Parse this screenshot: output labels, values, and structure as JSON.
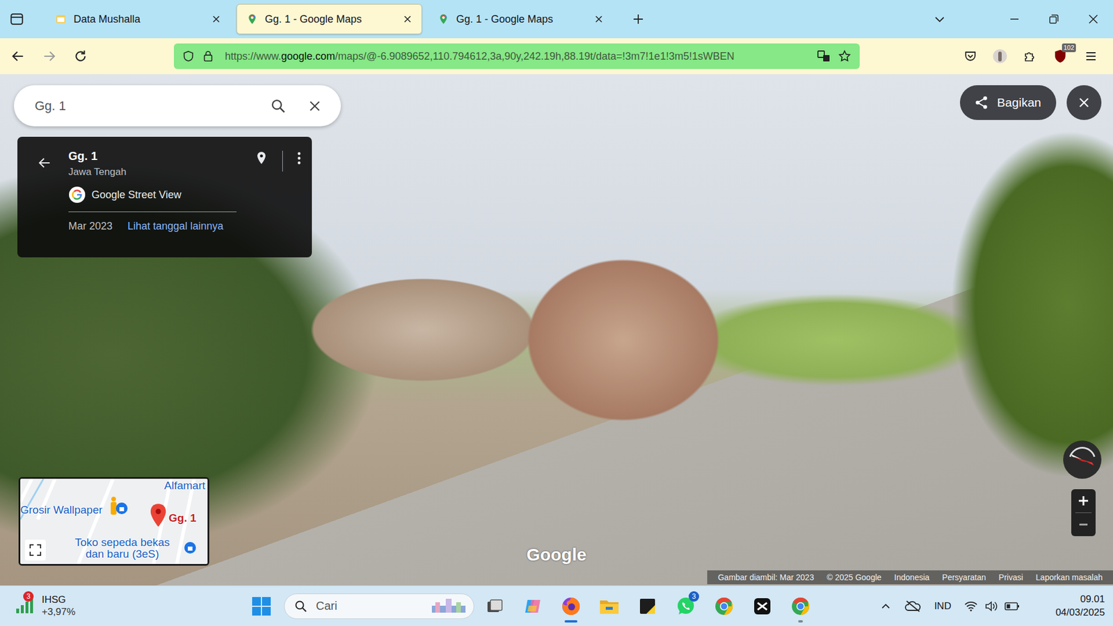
{
  "browser": {
    "tabs": [
      {
        "label": "Data Mushalla",
        "selected": false,
        "kind": "sheet"
      },
      {
        "label": "Gg. 1 - Google Maps",
        "selected": true,
        "kind": "maps"
      },
      {
        "label": "Gg. 1 - Google Maps",
        "selected": false,
        "kind": "maps"
      }
    ],
    "url": {
      "prefix": "https://www.",
      "domain": "google.com",
      "path": "/maps/@-6.9089652,110.794612,3a,90y,242.19h,88.19t/data=!3m7!1e1!3m5!1sWBEN"
    },
    "extension_badge": "102"
  },
  "maps": {
    "search": {
      "value": "Gg. 1"
    },
    "place": {
      "title": "Gg. 1",
      "region": "Jawa Tengah",
      "source": "Google Street View",
      "date": "Mar 2023",
      "link": "Lihat tanggal lainnya"
    },
    "share_button": "Bagikan",
    "minimap": {
      "labels": [
        {
          "text": "Alfamart",
          "kind": "poi"
        },
        {
          "text": "Grosir Wallpaper",
          "kind": "poi"
        },
        {
          "text": "Gg. 1",
          "kind": "pin"
        },
        {
          "text": "Toko sepeda bekas dan baru (3eS)",
          "kind": "poi"
        }
      ]
    },
    "watermark": "Google",
    "footer": [
      "Gambar diambil: Mar 2023",
      "© 2025 Google",
      "Indonesia",
      "Persyaratan",
      "Privasi",
      "Laporkan masalah"
    ]
  },
  "taskbar": {
    "widget": {
      "badge": "3",
      "name": "IHSG",
      "change": "+3,97%"
    },
    "search_placeholder": "Cari",
    "apps": [
      {
        "kind": "taskview",
        "active": false,
        "running": false,
        "badge": ""
      },
      {
        "kind": "copilot",
        "active": false,
        "running": false,
        "badge": ""
      },
      {
        "kind": "firefox",
        "active": true,
        "running": true,
        "badge": ""
      },
      {
        "kind": "folder",
        "active": false,
        "running": false,
        "badge": ""
      },
      {
        "kind": "sticky",
        "active": false,
        "running": false,
        "badge": ""
      },
      {
        "kind": "whatsapp",
        "active": false,
        "running": false,
        "badge": "3"
      },
      {
        "kind": "chrome",
        "active": false,
        "running": false,
        "badge": ""
      },
      {
        "kind": "capcut",
        "active": false,
        "running": false,
        "badge": ""
      },
      {
        "kind": "chrome",
        "active": false,
        "running": true,
        "badge": ""
      }
    ],
    "language": "IND",
    "clock": {
      "time": "09.01",
      "date": "04/03/2025"
    }
  }
}
